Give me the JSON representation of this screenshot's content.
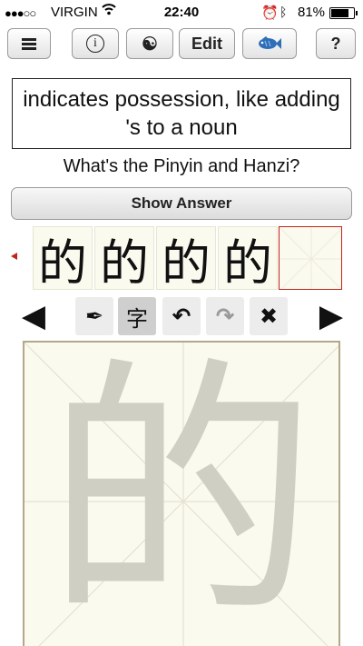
{
  "status_bar": {
    "signal": "●●●○○",
    "carrier": "VIRGIN",
    "wifi_icon": "wifi-icon",
    "time": "22:40",
    "alarm_icon": "alarm-icon",
    "bluetooth_icon": "bluetooth-icon",
    "battery_percent": "81%",
    "battery_level": 0.81
  },
  "toolbar": {
    "menu_icon": "hamburger-menu-icon",
    "info_symbol": "i",
    "yinyang_symbol": "☯",
    "edit_label": "Edit",
    "fish_symbol": "🐟",
    "help_label": "?"
  },
  "card": {
    "definition": "indicates possession, like adding 's to a noun",
    "question": "What's the Pinyin and Hanzi?",
    "show_answer_label": "Show Answer"
  },
  "history": {
    "attempts": [
      "的",
      "的",
      "的",
      "的"
    ]
  },
  "controls": {
    "prev_symbol": "◀",
    "pen_symbol": "✒",
    "char_symbol": "字",
    "undo_symbol": "↶",
    "redo_symbol": "↷",
    "clear_symbol": "✖",
    "next_symbol": "▶"
  },
  "canvas": {
    "guide_character": "的"
  }
}
